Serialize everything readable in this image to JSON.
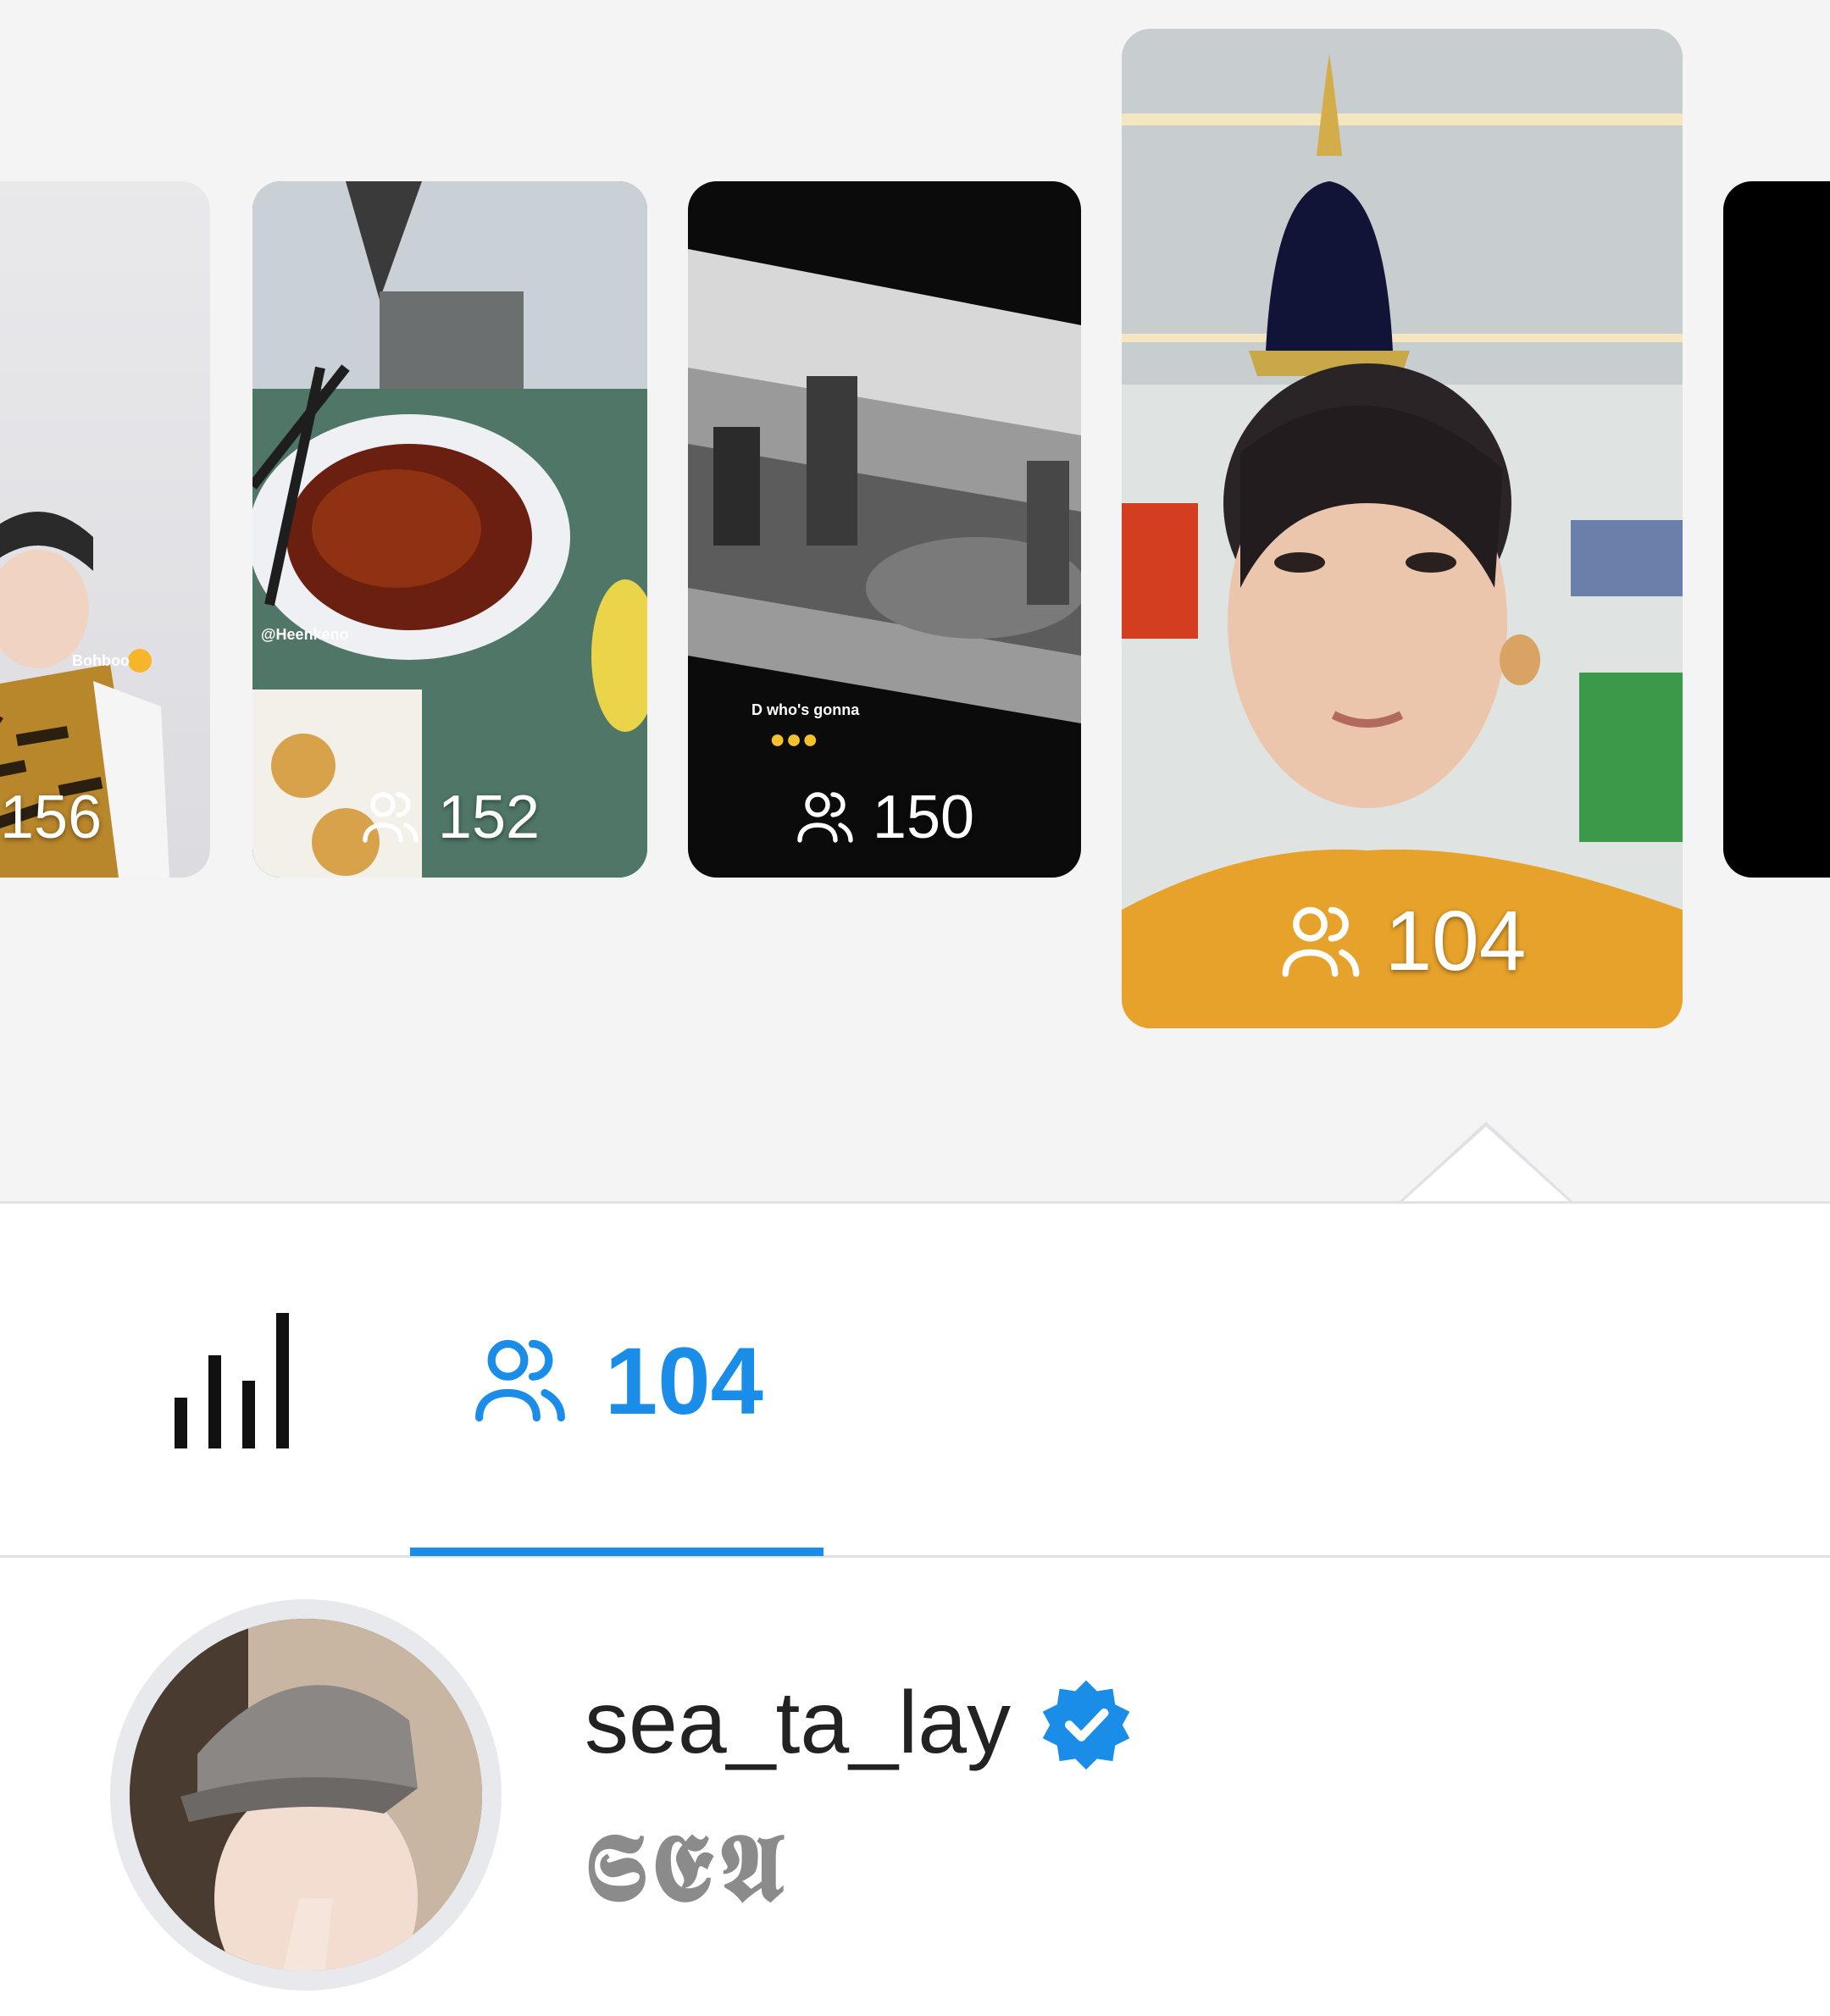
{
  "stories": [
    {
      "viewers": "156",
      "caption": "Bohboo"
    },
    {
      "viewers": "152",
      "caption": "@Heenkeno"
    },
    {
      "viewers": "150",
      "caption": "D who's gonna"
    },
    {
      "viewers": "104",
      "selected": true
    },
    {
      "viewers": ""
    }
  ],
  "tabs": {
    "insights_icon": "bar-chart-icon",
    "viewers_icon": "viewers-icon",
    "viewers_count": "104"
  },
  "profile": {
    "username": "sea_ta_lay",
    "verified": true,
    "display_name": "𝕾𝕰𝕬"
  },
  "colors": {
    "accent": "#1a8de8",
    "tray_background": "#f4f4f5",
    "verified_badge": "#1a8de8"
  }
}
